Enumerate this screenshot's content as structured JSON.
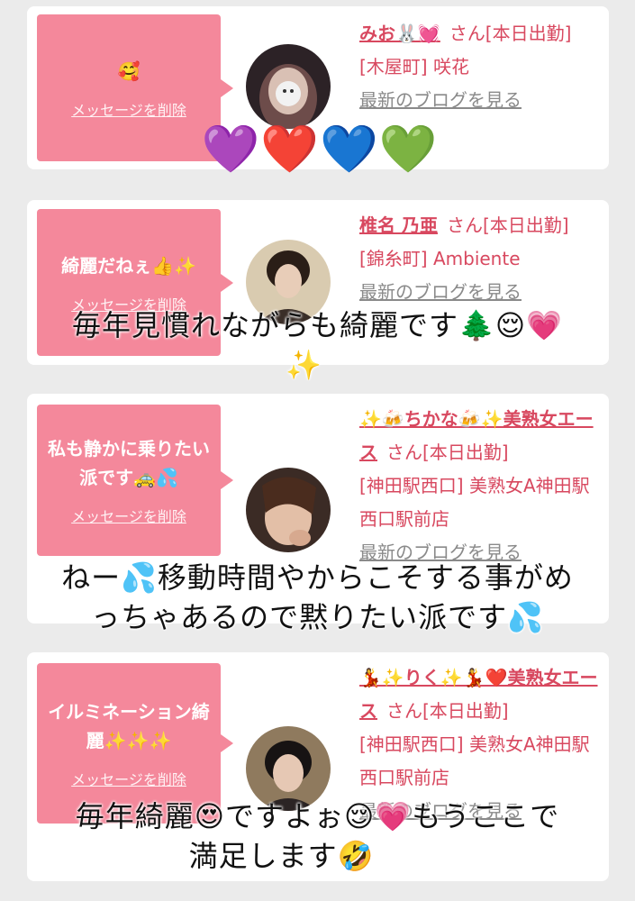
{
  "delete_label": "メッセージを削除",
  "blog_label": "最新のブログを見る",
  "colors": {
    "accent": "#d8485f",
    "bubble": "#f4889b",
    "background": "#ebebeb"
  },
  "cards": [
    {
      "message": "🥰",
      "name": "みお🐰💓",
      "suffix": "さん[本日出勤]",
      "location": "[木屋町] 咲花"
    },
    {
      "message": "綺麗だねぇ👍✨",
      "name": "椎名 乃亜",
      "suffix": "さん[本日出勤]",
      "location": "[錦糸町] Ambiente"
    },
    {
      "message": "私も静かに乗りたい派です🚕💦",
      "name": "✨🍻ちかな🍻✨美熟女エース",
      "suffix": "さん[本日出勤]",
      "location": "[神田駅西口] 美熟女A神田駅西口駅前店"
    },
    {
      "message": "イルミネーション綺麗✨✨✨",
      "name": "💃✨りく✨💃❤️美熟女エース",
      "suffix": "さん[本日出勤]",
      "location": "[神田駅西口] 美熟女A神田駅西口駅前店"
    }
  ],
  "overlays": {
    "hearts": "💜❤️💙💚",
    "t1": "毎年見慣れながらも綺麗です🌲😌💗",
    "t1b": "✨",
    "t2a": "ねー💦移動時間やからこそする事がめ",
    "t2b": "っちゃあるので黙りたい派です💦",
    "t3a": "毎年綺麗😍ですよぉ😌💗もうここで",
    "t3b": "満足します🤣"
  }
}
